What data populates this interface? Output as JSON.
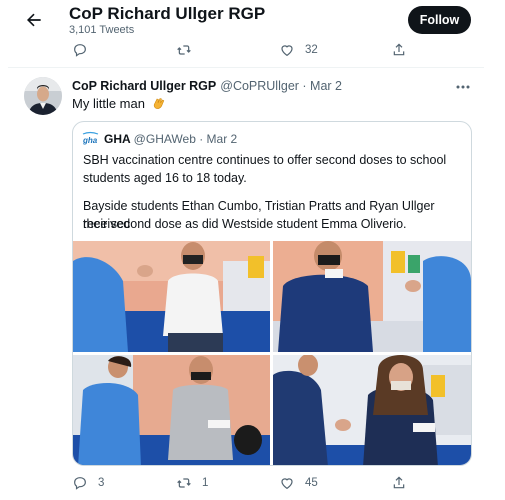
{
  "header": {
    "title": "CoP Richard Ullger RGP",
    "subtitle": "3,101 Tweets",
    "follow_label": "Follow"
  },
  "top_actions": {
    "replies": "",
    "retweets": "",
    "likes": "32"
  },
  "tweet": {
    "author_name": "CoP Richard Ullger RGP",
    "author_meta": "@CoPRUllger · Mar 2",
    "text": "My little man",
    "emoji": "clapping-hands"
  },
  "quoted": {
    "author_name": "GHA",
    "author_meta": "@GHAWeb · Mar 2",
    "logo_text": "gha",
    "line1": "SBH vaccination centre continues to offer second doses to school",
    "line2": "students aged 16 to 18 today.",
    "line3": "Bayside students Ethan Cumbo, Tristian Pratts and Ryan Ullger received",
    "line4": "their second dose as did Westside student Emma Oliverio."
  },
  "bottom_actions": {
    "replies": "3",
    "retweets": "1",
    "likes": "45"
  },
  "colors": {
    "text": "#0f1419",
    "muted": "#536471",
    "border": "#cfd9de",
    "follow_bg": "#0f1419",
    "clap": "#f5b335"
  }
}
